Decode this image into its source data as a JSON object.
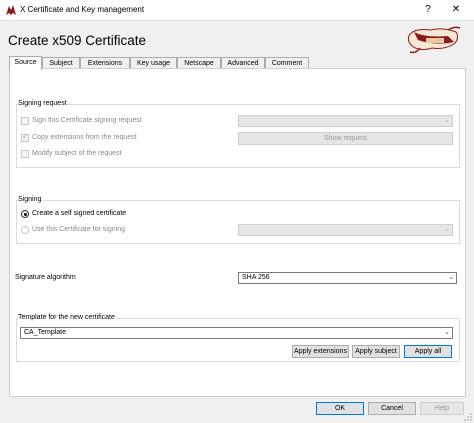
{
  "window": {
    "title": "X Certificate and Key management",
    "help_label": "?",
    "close_label": "✕"
  },
  "heading": "Create x509 Certificate",
  "tabs": [
    {
      "label": "Source",
      "active": true
    },
    {
      "label": "Subject"
    },
    {
      "label": "Extensions"
    },
    {
      "label": "Key usage"
    },
    {
      "label": "Netscape"
    },
    {
      "label": "Advanced"
    },
    {
      "label": "Comment"
    }
  ],
  "signing_request": {
    "title": "Signing request",
    "sign_label": "Sign this Certificate signing request",
    "copy_label": "Copy extensions from the request",
    "modify_label": "Modify subject of the request",
    "show_button": "Show request"
  },
  "signing": {
    "title": "Signing",
    "self_signed_label": "Create a self signed certificate",
    "use_cert_label": "Use this Certificate for signing"
  },
  "signature_algorithm": {
    "label": "Signature algorithm",
    "value": "SHA 256"
  },
  "template": {
    "title": "Template for the new certificate",
    "value": "CA_Template",
    "apply_extensions": "Apply extensions",
    "apply_subject": "Apply subject",
    "apply_all": "Apply all"
  },
  "footer": {
    "ok": "OK",
    "cancel": "Cancel",
    "help": "Help"
  },
  "colors": {
    "accent": "#0078d7",
    "logo_red": "#8b1a1a"
  }
}
